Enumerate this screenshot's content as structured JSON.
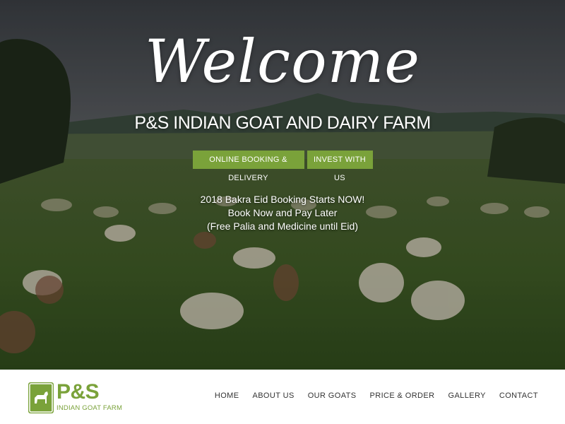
{
  "hero": {
    "welcome": "Welcome",
    "title": "P&S INDIAN GOAT AND DAIRY FARM",
    "buttons": {
      "booking": "ONLINE BOOKING & DELIVERY",
      "invest": "INVEST WITH US"
    },
    "announcement": [
      "2018 Bakra Eid Booking Starts NOW!",
      "Book Now and Pay Later",
      "(Free Palia and Medicine until Eid)"
    ]
  },
  "nav": {
    "logo": {
      "main": "P&S",
      "sub": "INDIAN GOAT FARM",
      "icon": "goat-icon"
    },
    "items": [
      "HOME",
      "ABOUT US",
      "OUR GOATS",
      "PRICE & ORDER",
      "GALLERY",
      "CONTACT"
    ]
  },
  "colors": {
    "accent": "#7aa23a",
    "nav_text": "#333333"
  }
}
